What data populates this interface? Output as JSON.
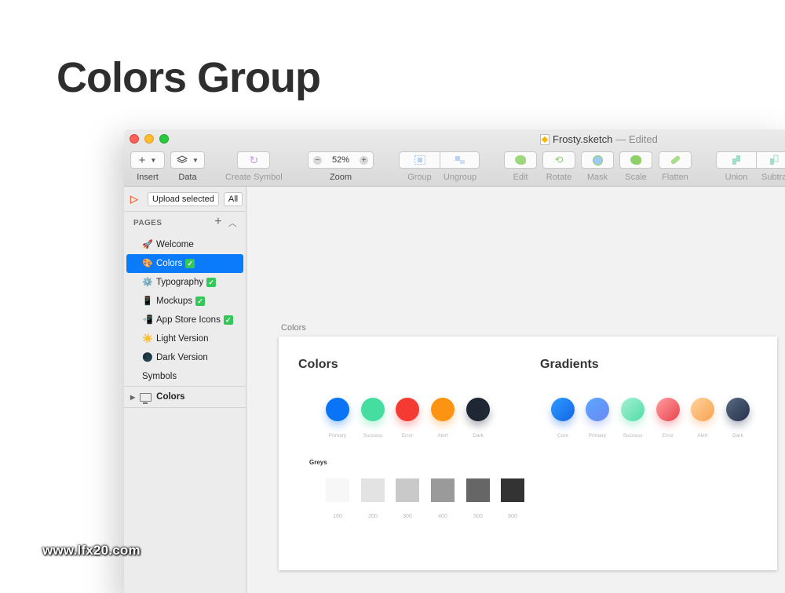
{
  "heading": "Colors Group",
  "window": {
    "doc_name": "Frosty.sketch",
    "doc_status": "— Edited",
    "traffic_lights": [
      "close",
      "minimize",
      "zoom"
    ]
  },
  "toolbar": {
    "insert_label": "Insert",
    "data_label": "Data",
    "create_symbol_label": "Create Symbol",
    "zoom_value": "52%",
    "zoom_label": "Zoom",
    "group_label": "Group",
    "ungroup_label": "Ungroup",
    "edit_label": "Edit",
    "rotate_label": "Rotate",
    "mask_label": "Mask",
    "scale_label": "Scale",
    "flatten_label": "Flatten",
    "union_label": "Union",
    "subtract_label": "Subtract"
  },
  "sidebar": {
    "upload_label": "Upload selected",
    "all_label": "All",
    "pages_header": "PAGES",
    "pages": [
      {
        "icon": "🚀",
        "label": "Welcome",
        "check": false
      },
      {
        "icon": "🎨",
        "label": "Colors",
        "check": true
      },
      {
        "icon": "⚙️",
        "label": "Typography",
        "check": true
      },
      {
        "icon": "📱",
        "label": "Mockups",
        "check": true
      },
      {
        "icon": "📲",
        "label": "App Store Icons",
        "check": true
      },
      {
        "icon": "☀️",
        "label": "Light Version",
        "check": false
      },
      {
        "icon": "🌑",
        "label": "Dark Version",
        "check": false
      },
      {
        "icon": "",
        "label": "Symbols",
        "check": false
      }
    ],
    "selected_page": "Colors",
    "layer": "Colors"
  },
  "artboard": {
    "name": "Colors",
    "colors_title": "Colors",
    "gradients_title": "Gradients",
    "colors": [
      {
        "label": "Primary",
        "color": "#0a74f6"
      },
      {
        "label": "Success",
        "color": "#46dea0"
      },
      {
        "label": "Error",
        "color": "#f53a33"
      },
      {
        "label": "Alert",
        "color": "#fd9312"
      },
      {
        "label": "Dark",
        "color": "#1e2733"
      }
    ],
    "gradients": [
      {
        "label": "Core",
        "from": "#2d9bff",
        "to": "#1565e6"
      },
      {
        "label": "Primary",
        "from": "#5aa8ff",
        "to": "#6b87f2"
      },
      {
        "label": "Success",
        "from": "#a3f0d5",
        "to": "#53dca7"
      },
      {
        "label": "Error",
        "from": "#ff9ea0",
        "to": "#e9434c"
      },
      {
        "label": "Alert",
        "from": "#ffd29a",
        "to": "#f7a352"
      },
      {
        "label": "Dark",
        "from": "#5a6a82",
        "to": "#23304a"
      }
    ],
    "greys_title": "Greys",
    "greys": [
      {
        "label": "100",
        "color": "#f7f7f7"
      },
      {
        "label": "200",
        "color": "#e3e3e3"
      },
      {
        "label": "300",
        "color": "#c9c9c9"
      },
      {
        "label": "400",
        "color": "#9a9a9a"
      },
      {
        "label": "500",
        "color": "#666666"
      },
      {
        "label": "600",
        "color": "#333333"
      }
    ]
  },
  "watermark": "www.lfx20.com",
  "colors": {
    "accent": "#0a7bfb",
    "heading": "#2e2e2e"
  }
}
